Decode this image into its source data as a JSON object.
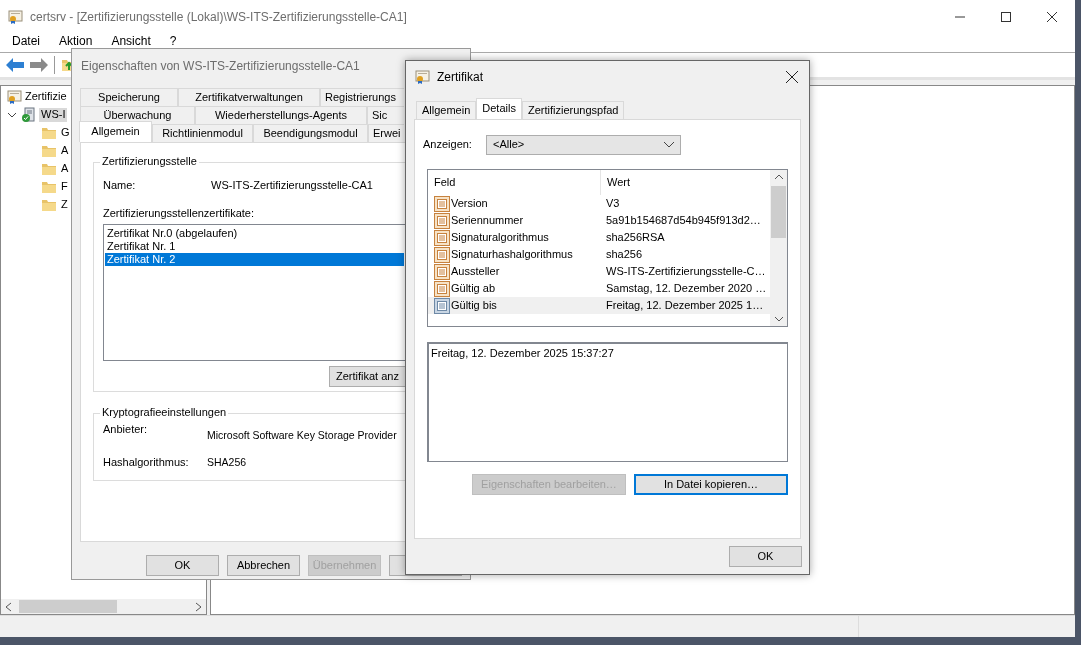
{
  "main_window": {
    "title": "certsrv - [Zertifizierungsstelle (Lokal)\\WS-ITS-Zertifizierungsstelle-CA1]",
    "menu": [
      "Datei",
      "Aktion",
      "Ansicht",
      "?"
    ],
    "tree": [
      {
        "label": "Zertifizie",
        "selected": false,
        "children": [
          {
            "label": "WS-I",
            "selected": true,
            "expanded": true,
            "children": [
              {
                "label": "G",
                "selected": false
              },
              {
                "label": "A",
                "selected": false
              },
              {
                "label": "A",
                "selected": false
              },
              {
                "label": "F",
                "selected": false
              },
              {
                "label": "Z",
                "selected": false
              }
            ]
          }
        ]
      }
    ]
  },
  "properties_dialog": {
    "title": "Eigenschaften von WS-ITS-Zertifizierungsstelle-CA1",
    "tab_rows": [
      [
        {
          "label": "Speicherung",
          "selected": false
        },
        {
          "label": "Zertifikatverwaltungen",
          "selected": false
        },
        {
          "label": "Registrierungs",
          "selected": false
        }
      ],
      [
        {
          "label": "Überwachung",
          "selected": false
        },
        {
          "label": "Wiederherstellungs-Agents",
          "selected": false
        },
        {
          "label": "Sic",
          "selected": false
        }
      ],
      [
        {
          "label": "Allgemein",
          "selected": true
        },
        {
          "label": "Richtlinienmodul",
          "selected": false
        },
        {
          "label": "Beendigungsmodul",
          "selected": false
        },
        {
          "label": "Erwei",
          "selected": false
        }
      ]
    ],
    "ca_group": {
      "title": "Zertifizierungsstelle",
      "name_label": "Name:",
      "name_value": "WS-ITS-Zertifizierungsstelle-CA1",
      "certs_label": "Zertifizierungsstellenzertifikate:",
      "certificates": [
        {
          "label": "Zertifikat Nr.0 (abgelaufen)",
          "selected": false
        },
        {
          "label": "Zertifikat Nr. 1",
          "selected": false
        },
        {
          "label": "Zertifikat Nr. 2",
          "selected": true
        }
      ],
      "view_button": "Zertifikat anz"
    },
    "crypto_group": {
      "title": "Kryptografieeinstellungen",
      "rows": [
        {
          "label": "Anbieter:",
          "value": "Microsoft Software Key Storage Provider"
        },
        {
          "label": "Hashalgorithmus:",
          "value": "SHA256"
        }
      ]
    },
    "buttons": [
      {
        "label": "OK",
        "disabled": false
      },
      {
        "label": "Abbrechen",
        "disabled": false
      },
      {
        "label": "Übernehmen",
        "disabled": true
      }
    ]
  },
  "certificate_dialog": {
    "title": "Zertifikat",
    "tabs": [
      {
        "label": "Allgemein",
        "selected": false
      },
      {
        "label": "Details",
        "selected": true
      },
      {
        "label": "Zertifizierungspfad",
        "selected": false
      }
    ],
    "show_label": "Anzeigen:",
    "show_value": "<Alle>",
    "columns": [
      "Feld",
      "Wert"
    ],
    "rows": [
      {
        "field": "Version",
        "value": "V3",
        "selected": false
      },
      {
        "field": "Seriennummer",
        "value": "5a91b154687d54b945f913d2…",
        "selected": false
      },
      {
        "field": "Signaturalgorithmus",
        "value": "sha256RSA",
        "selected": false
      },
      {
        "field": "Signaturhashalgorithmus",
        "value": "sha256",
        "selected": false
      },
      {
        "field": "Aussteller",
        "value": "WS-ITS-Zertifizierungsstelle-C…",
        "selected": false
      },
      {
        "field": "Gültig ab",
        "value": "Samstag, 12. Dezember 2020 …",
        "selected": false
      },
      {
        "field": "Gültig bis",
        "value": "Freitag, 12. Dezember 2025 1…",
        "selected": true
      }
    ],
    "detail_text": "Freitag, 12. Dezember 2025 15:37:27",
    "buttons": [
      {
        "label": "Eigenschaften bearbeiten…",
        "disabled": true,
        "focused": false
      },
      {
        "label": "In Datei kopieren…",
        "disabled": false,
        "focused": true
      }
    ],
    "ok_button": "OK"
  }
}
